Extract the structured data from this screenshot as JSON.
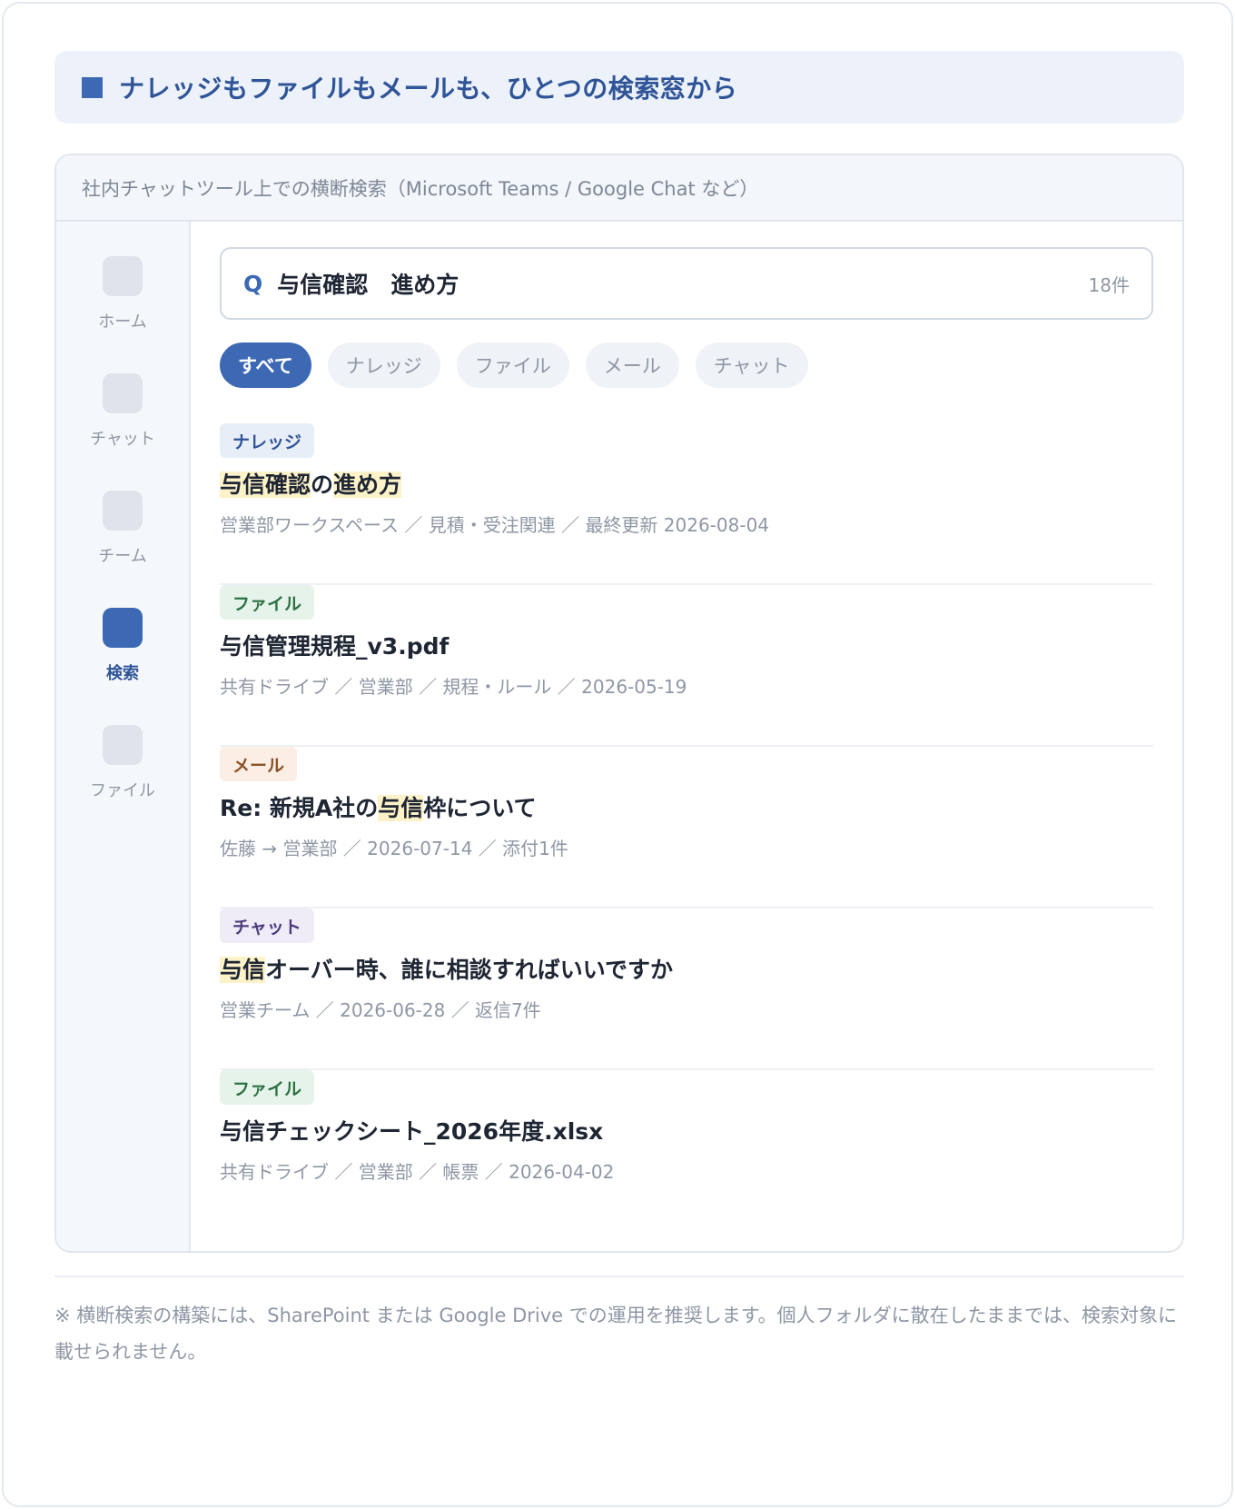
{
  "heading": {
    "title": "ナレッジもファイルもメールも、ひとつの検索窓から"
  },
  "window": {
    "header": "社内チャットツール上での横断検索（Microsoft Teams / Google Chat など）"
  },
  "sidebar": {
    "items": [
      {
        "label": "ホーム",
        "icon": "home-icon",
        "active": false
      },
      {
        "label": "チャット",
        "icon": "chat-icon",
        "active": false
      },
      {
        "label": "チーム",
        "icon": "team-icon",
        "active": false
      },
      {
        "label": "検索",
        "icon": "search-icon",
        "active": true
      },
      {
        "label": "ファイル",
        "icon": "file-icon",
        "active": false
      }
    ]
  },
  "search": {
    "icon_label": "Q",
    "query": "与信確認　進め方",
    "count": "18件"
  },
  "filters": [
    {
      "label": "すべて",
      "active": true
    },
    {
      "label": "ナレッジ",
      "active": false
    },
    {
      "label": "ファイル",
      "active": false
    },
    {
      "label": "メール",
      "active": false
    },
    {
      "label": "チャット",
      "active": false
    }
  ],
  "results": [
    {
      "tag": "ナレッジ",
      "type": "knowledge",
      "title_parts": [
        {
          "text": "与信確認",
          "hl": true
        },
        {
          "text": "の",
          "hl": false
        },
        {
          "text": "進め方",
          "hl": true
        }
      ],
      "meta": "営業部ワークスペース ／ 見積・受注関連 ／ 最終更新 2026-08-04"
    },
    {
      "tag": "ファイル",
      "type": "file",
      "title_parts": [
        {
          "text": "与信管理規程_v3.pdf",
          "hl": false
        }
      ],
      "meta": "共有ドライブ ／ 営業部 ／ 規程・ルール ／ 2026-05-19"
    },
    {
      "tag": "メール",
      "type": "mail",
      "title_parts": [
        {
          "text": "Re: 新規A社の",
          "hl": false
        },
        {
          "text": "与信",
          "hl": true
        },
        {
          "text": "枠について",
          "hl": false
        }
      ],
      "meta": "佐藤 → 営業部 ／ 2026-07-14 ／ 添付1件"
    },
    {
      "tag": "チャット",
      "type": "chat",
      "title_parts": [
        {
          "text": "与信",
          "hl": true
        },
        {
          "text": "オーバー時、誰に相談すればいいですか",
          "hl": false
        }
      ],
      "meta": "営業チーム ／ 2026-06-28 ／ 返信7件"
    },
    {
      "tag": "ファイル",
      "type": "file",
      "title_parts": [
        {
          "text": "与信チェックシート_2026年度.xlsx",
          "hl": false
        }
      ],
      "meta": "共有ドライブ ／ 営業部 ／ 帳票 ／ 2026-04-02"
    }
  ],
  "note": "※ 横断検索の構築には、SharePoint または Google Drive での運用を推奨します。個人フォルダに散在したままでは、検索対象に載せられません。"
}
